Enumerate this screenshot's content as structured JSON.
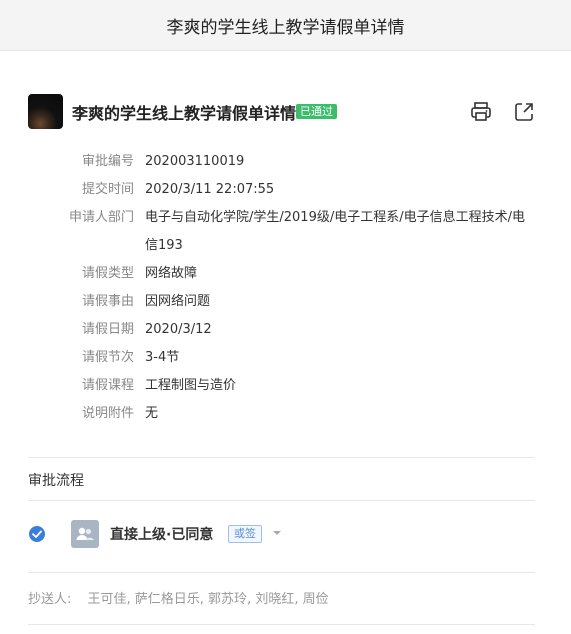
{
  "page_title": "李爽的学生线上教学请假单详情",
  "header": {
    "title": "李爽的学生线上教学请假单详情",
    "status_badge": "已通过",
    "status_color": "#3dbd6b"
  },
  "fields": [
    {
      "label": "审批编号",
      "value": "202003110019"
    },
    {
      "label": "提交时间",
      "value": "2020/3/11 22:07:55"
    },
    {
      "label": "申请人部门",
      "value": "电子与自动化学院/学生/2019级/电子工程系/电子信息工程技术/电信193"
    },
    {
      "label": "请假类型",
      "value": "网络故障"
    },
    {
      "label": "请假事由",
      "value": "因网络问题"
    },
    {
      "label": "请假日期",
      "value": "2020/3/12"
    },
    {
      "label": "请假节次",
      "value": "3-4节"
    },
    {
      "label": "请假课程",
      "value": "工程制图与造价"
    },
    {
      "label": "说明附件",
      "value": "无"
    }
  ],
  "approval_section": {
    "title": "审批流程",
    "step": {
      "label": "直接上级·已同意",
      "sign_type": "或签",
      "status_icon": "check-circle-icon",
      "avatar_icon": "group-icon"
    },
    "cc": {
      "label": "抄送人:",
      "names": "王可佳, 萨仁格日乐, 郭苏玲, 刘晓红, 周俭"
    }
  },
  "icons": {
    "print": "print-icon",
    "export": "export-icon",
    "dropdown": "caret-down-icon"
  },
  "colors": {
    "accent_blue": "#3b7ddd",
    "approved_green": "#3dbd6b"
  }
}
